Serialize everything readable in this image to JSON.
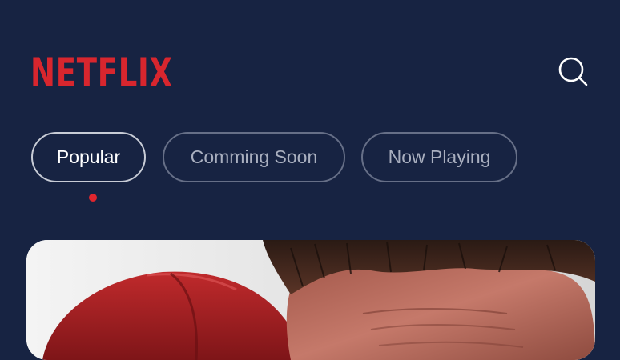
{
  "brand": {
    "logo_text": "NETFLIX",
    "logo_color": "#d8262e"
  },
  "theme": {
    "background": "#172342",
    "active_indicator": "#e0262e"
  },
  "header": {
    "search_icon": "search-icon"
  },
  "tabs": [
    {
      "label": "Popular",
      "active": true
    },
    {
      "label": "Comming Soon",
      "active": false
    },
    {
      "label": "Now Playing",
      "active": false
    }
  ]
}
